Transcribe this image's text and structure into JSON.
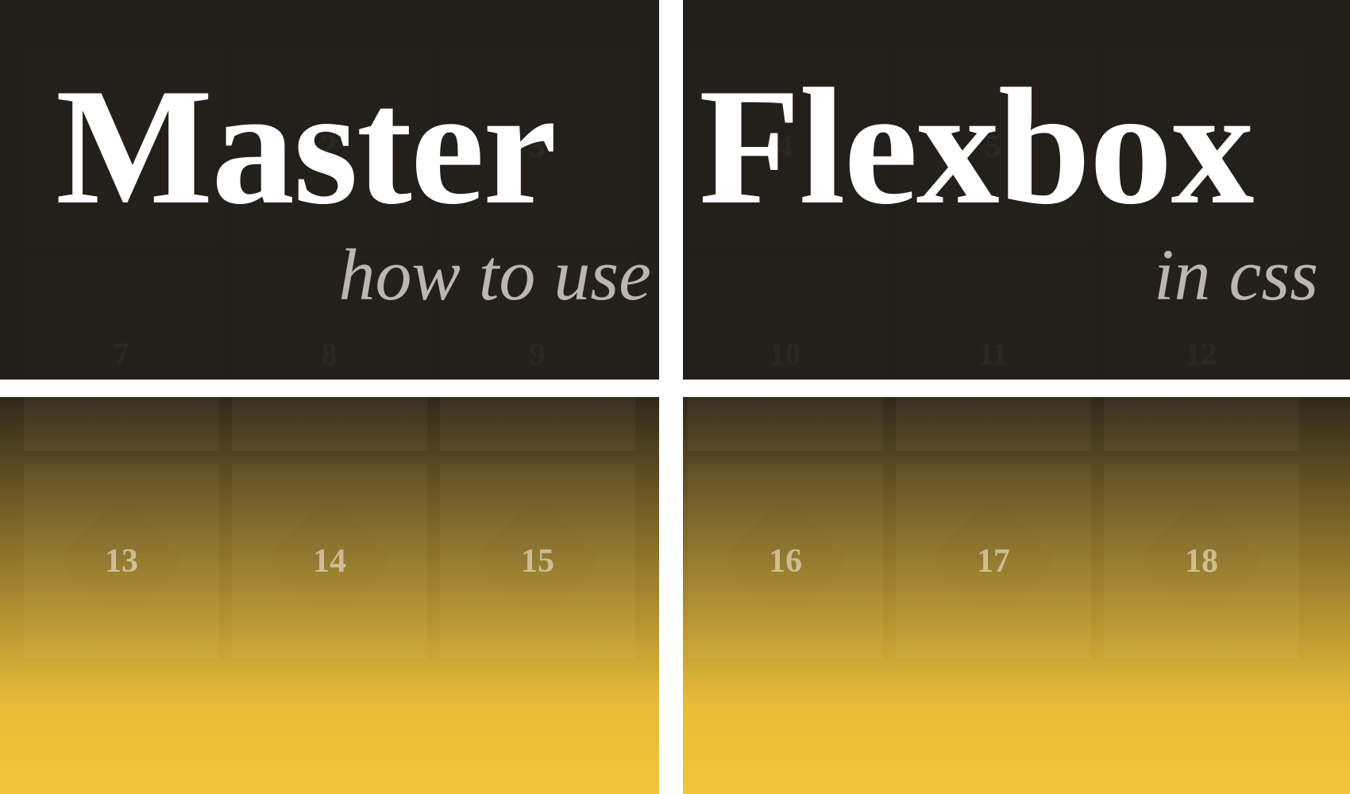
{
  "headline": {
    "master": "Master",
    "howto": "how to use",
    "flexbox": "Flexbox",
    "incss": "in css"
  },
  "tiles": {
    "n1": "1",
    "n2": "2",
    "n3": "3",
    "n4": "4",
    "n5": "5",
    "n6": "6",
    "n7": "7",
    "n8": "8",
    "n9": "9",
    "n10": "10",
    "n11": "11",
    "n12": "12",
    "n13": "13",
    "n14": "14",
    "n15": "15",
    "n16": "16",
    "n17": "17",
    "n18": "18"
  },
  "colors": {
    "bg_dark": "#231e1a",
    "tile_dark": "#2d2722",
    "gold": "#efbc25",
    "text_white": "#ffffff",
    "text_sub": "#bcb6ae",
    "num": "#8c847b"
  }
}
